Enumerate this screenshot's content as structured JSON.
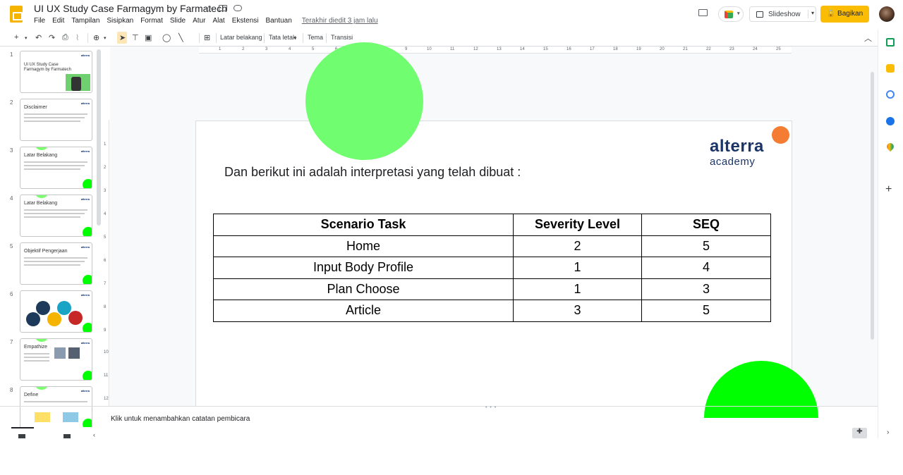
{
  "app": {
    "title": "UI UX Study Case Farmagym by Farmatech",
    "menu": [
      "File",
      "Edit",
      "Tampilan",
      "Sisipkan",
      "Format",
      "Slide",
      "Atur",
      "Alat",
      "Ekstensi",
      "Bantuan"
    ],
    "last_edit": "Terakhir diedit 3 jam lalu",
    "slideshow_label": "Slideshow",
    "share_label": "Bagikan"
  },
  "toolbar": {
    "background_label": "Latar belakang",
    "layout_label": "Tata letak",
    "theme_label": "Tema",
    "transition_label": "Transisi"
  },
  "filmstrip": {
    "slides": [
      {
        "num": "1",
        "title": "UI UX Study Case\nFarmagym by Farmatech"
      },
      {
        "num": "2",
        "title": "Disclaimer"
      },
      {
        "num": "3",
        "title": "Latar Belakang"
      },
      {
        "num": "4",
        "title": "Latar Belakang"
      },
      {
        "num": "5",
        "title": "Objektif Pengerjaan"
      },
      {
        "num": "6",
        "title": ""
      },
      {
        "num": "7",
        "title": "Empathize"
      },
      {
        "num": "8",
        "title": "Define"
      }
    ]
  },
  "slide": {
    "brand": "alterra",
    "brand_sub": "academy",
    "heading": "Dan berikut ini adalah interpretasi yang telah dibuat :",
    "table": {
      "headers": [
        "Scenario Task",
        "Severity Level",
        "SEQ"
      ],
      "rows": [
        [
          "Home",
          "2",
          "5"
        ],
        [
          "Input Body Profile",
          "1",
          "4"
        ],
        [
          "Plan Choose",
          "1",
          "3"
        ],
        [
          "Article",
          "3",
          "5"
        ]
      ]
    }
  },
  "notes": {
    "placeholder": "Klik untuk menambahkan catatan pembicara"
  },
  "colors": {
    "accent": "#fbbc04",
    "green_circle_top": "#70fd70",
    "green_circle_bottom": "#00ff00",
    "brand_blue": "#1b3569",
    "brand_orange": "#f47c33"
  }
}
